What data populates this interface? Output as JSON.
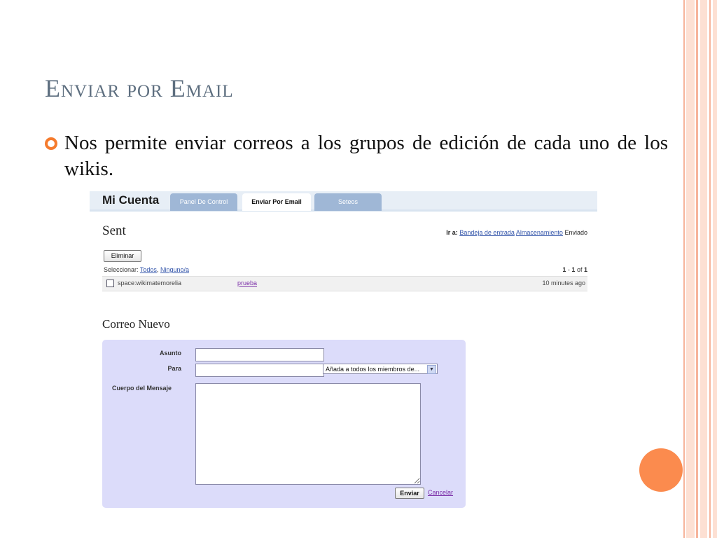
{
  "slide": {
    "title": "Enviar por Email",
    "bullet": "Nos permite enviar correos a los grupos de edición de cada uno de los wikis."
  },
  "app": {
    "brand": "Mi Cuenta",
    "tabs": [
      {
        "label": "Panel De Control",
        "active": false
      },
      {
        "label": "Enviar Por Email",
        "active": true
      },
      {
        "label": "Seteos",
        "active": false
      }
    ]
  },
  "sent": {
    "heading": "Sent",
    "goto_label": "Ir a:",
    "goto_links": [
      "Bandeja de entrada",
      "Almacenamiento"
    ],
    "goto_current": "Enviado",
    "delete_button": "Eliminar",
    "select_label": "Seleccionar:",
    "select_all": "Todos",
    "select_none": "Ninguno/a",
    "count_range_start": "1",
    "count_range_end": "1",
    "count_of": "of",
    "count_total": "1",
    "messages": [
      {
        "from": "space:wikimatemorelia",
        "subject": "prueba",
        "time": "10 minutes ago",
        "checked": false
      }
    ]
  },
  "compose": {
    "heading": "Correo Nuevo",
    "subject_label": "Asunto",
    "subject_value": "",
    "to_label": "Para",
    "to_value": "",
    "to_select": "Añada a todos los miembros de...",
    "body_label": "Cuerpo del Mensaje",
    "body_value": "",
    "send_button": "Enviar",
    "cancel_link": "Cancelar"
  },
  "colors": {
    "accent_orange": "#fb8b4e",
    "title_color": "#5d6e7f",
    "form_bg": "#dcdcfa",
    "tab_inactive": "#9fb7d6"
  }
}
